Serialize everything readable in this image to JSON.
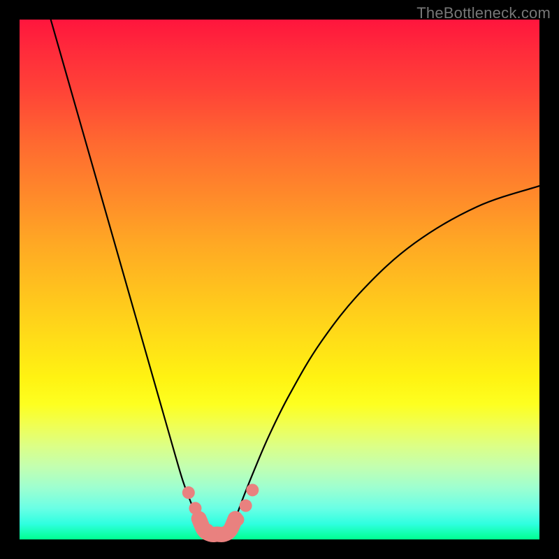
{
  "watermark": "TheBottleneck.com",
  "colors": {
    "frame_bg": "#000000",
    "gradient_top": "#ff153d",
    "gradient_bottom": "#00ff90",
    "curve_stroke": "#000000",
    "marker_fill": "#e9817f"
  },
  "chart_data": {
    "type": "line",
    "title": "",
    "xlabel": "",
    "ylabel": "",
    "xlim": [
      0,
      100
    ],
    "ylim": [
      0,
      100
    ],
    "grid": false,
    "legend": false,
    "series": [
      {
        "name": "left-branch",
        "x": [
          6,
          10,
          14,
          18,
          22,
          26,
          28,
          30,
          31.5,
          33,
          34,
          35,
          36
        ],
        "values": [
          100,
          86,
          72,
          58,
          44,
          30,
          23,
          16,
          11,
          7,
          4.5,
          2.5,
          1
        ]
      },
      {
        "name": "right-branch",
        "x": [
          40,
          41.5,
          43,
          45,
          48,
          52,
          58,
          66,
          76,
          88,
          100
        ],
        "values": [
          1,
          4,
          8,
          13,
          20,
          28,
          38,
          48,
          57,
          64,
          68
        ]
      }
    ],
    "markers": {
      "name": "bottleneck-region-dots",
      "x": [
        32.5,
        33.8,
        35.0,
        36.2,
        37.5,
        39.0,
        40.5,
        42.0,
        43.5,
        44.8
      ],
      "values": [
        9.0,
        6.0,
        3.5,
        1.8,
        1.2,
        1.2,
        1.8,
        3.8,
        6.5,
        9.5
      ]
    },
    "u_shape": {
      "name": "bottleneck-u",
      "x": [
        34.5,
        35.5,
        36.8,
        38.0,
        39.3,
        40.5,
        41.5
      ],
      "values": [
        4.0,
        1.8,
        1.0,
        1.0,
        1.0,
        1.8,
        4.0
      ]
    }
  }
}
